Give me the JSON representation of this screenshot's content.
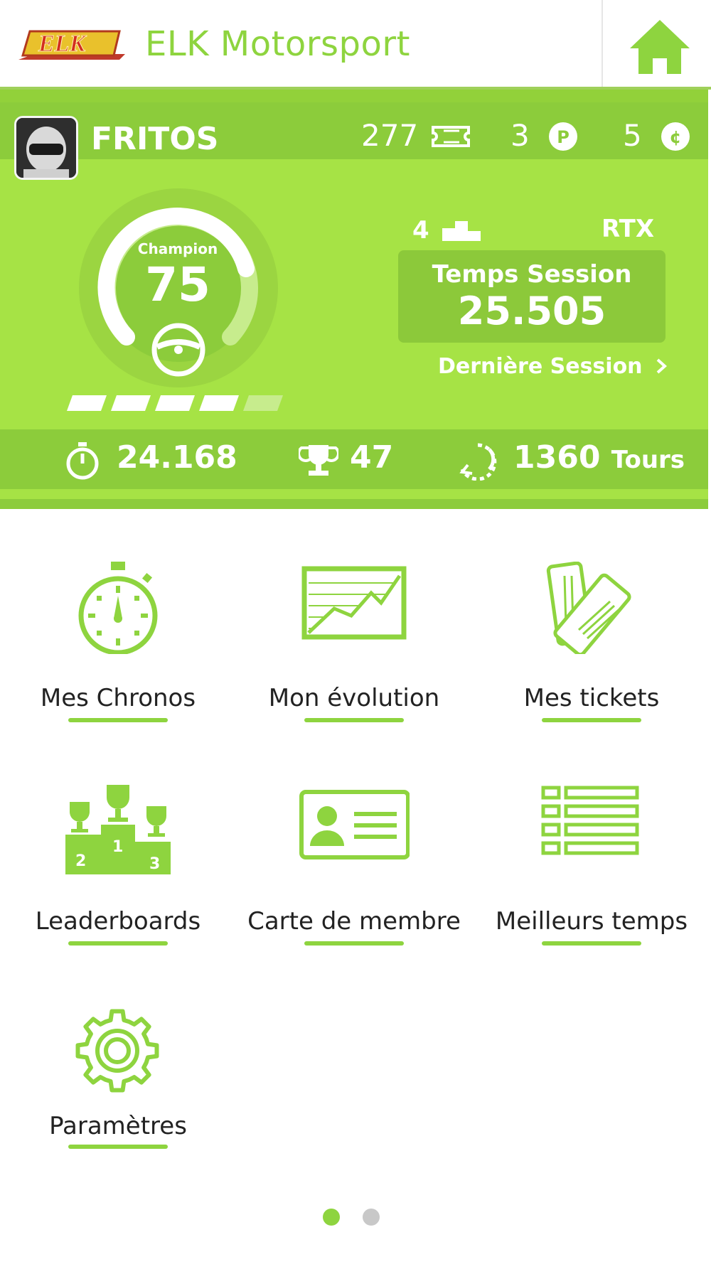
{
  "header": {
    "logo_text": "ELK",
    "title": "ELK Motorsport",
    "home_icon": "home-icon"
  },
  "profile": {
    "username": "FRITOS",
    "tickets": "277",
    "points": "3",
    "credits": "5",
    "rank_label": "Champion",
    "level": "75",
    "progress_filled": 4,
    "progress_total": 5,
    "position": "4",
    "kart_model": "RTX",
    "session_label": "Temps Session",
    "session_time": "25.505",
    "last_session_link": "Dernière Session",
    "best_time": "24.168",
    "trophies": "47",
    "laps": "1360",
    "laps_unit": "Tours"
  },
  "menu": [
    {
      "label": "Mes Chronos",
      "icon": "stopwatch-icon"
    },
    {
      "label": "Mon évolution",
      "icon": "line-chart-icon"
    },
    {
      "label": "Mes tickets",
      "icon": "tickets-icon"
    },
    {
      "label": "Leaderboards",
      "icon": "podium-icon"
    },
    {
      "label": "Carte de membre",
      "icon": "id-card-icon"
    },
    {
      "label": "Meilleurs temps",
      "icon": "list-icon"
    },
    {
      "label": "Paramètres",
      "icon": "gear-icon"
    }
  ],
  "pagination": {
    "pages": 2,
    "active": 1
  },
  "colors": {
    "accent": "#8ed43f",
    "panel": "#a6e345",
    "panel_dark": "#8ccc3b",
    "dot_inactive": "#c8c8c8"
  }
}
